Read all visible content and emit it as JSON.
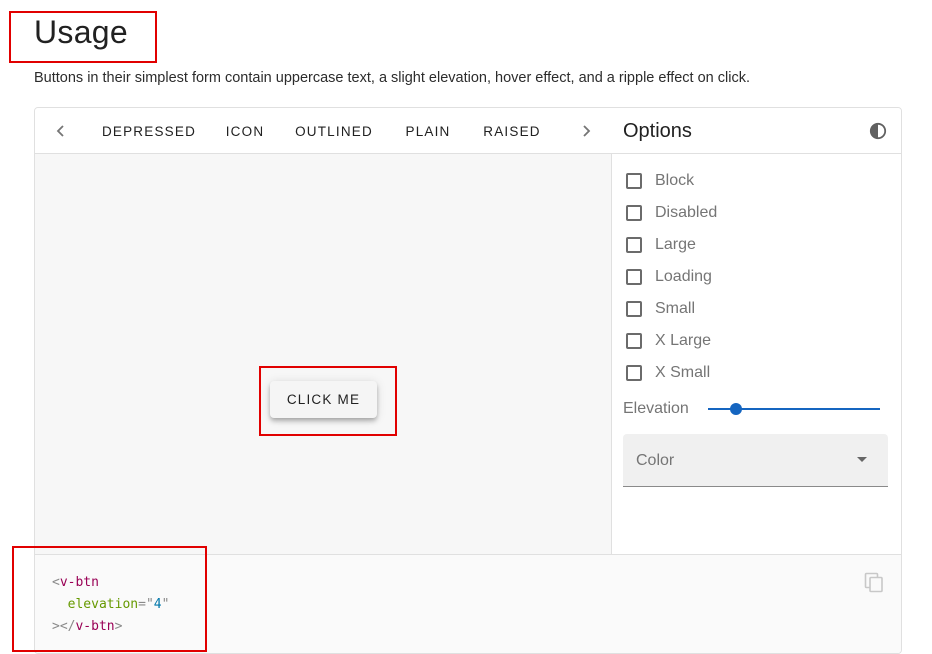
{
  "header": {
    "title": "Usage",
    "description": "Buttons in their simplest form contain uppercase text, a slight elevation, hover effect, and a ripple effect on click."
  },
  "tabs": {
    "items": [
      "DEPRESSED",
      "ICON",
      "OUTLINED",
      "PLAIN",
      "RAISED"
    ],
    "prev_icon": "chevron-left-icon",
    "next_icon": "chevron-right-icon"
  },
  "preview": {
    "button_label": "CLICK ME"
  },
  "options": {
    "title": "Options",
    "theme_icon": "contrast-icon",
    "checkboxes": [
      "Block",
      "Disabled",
      "Large",
      "Loading",
      "Small",
      "X Large",
      "X Small"
    ],
    "elevation_label": "Elevation",
    "elevation_value": 4,
    "color_placeholder": "Color",
    "accent_color": "#1565c0"
  },
  "code": {
    "open_punct": "<",
    "tag": "v-btn",
    "attr_name": "elevation",
    "attr_eq": "=",
    "attr_quote": "\"",
    "attr_value": "4",
    "close_open": "></",
    "close_end": ">",
    "copy_icon": "copy-icon"
  },
  "annotation_color": "#e10000"
}
